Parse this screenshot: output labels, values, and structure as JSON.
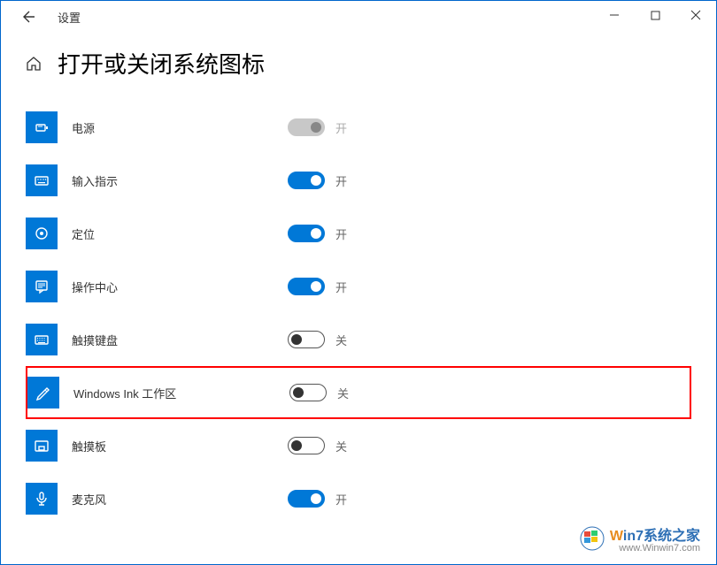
{
  "window": {
    "title": "设置"
  },
  "page": {
    "heading": "打开或关闭系统图标"
  },
  "state_labels": {
    "on": "开",
    "off": "关"
  },
  "items": [
    {
      "icon": "power",
      "label": "电源",
      "state": "on",
      "disabled": true
    },
    {
      "icon": "keyboard-ime",
      "label": "输入指示",
      "state": "on",
      "disabled": false
    },
    {
      "icon": "location",
      "label": "定位",
      "state": "on",
      "disabled": false
    },
    {
      "icon": "action-center",
      "label": "操作中心",
      "state": "on",
      "disabled": false
    },
    {
      "icon": "touch-keyboard",
      "label": "触摸键盘",
      "state": "off",
      "disabled": false
    },
    {
      "icon": "windows-ink",
      "label": "Windows Ink 工作区",
      "state": "off",
      "disabled": false,
      "highlighted": true
    },
    {
      "icon": "touchpad",
      "label": "触摸板",
      "state": "off",
      "disabled": false
    },
    {
      "icon": "microphone",
      "label": "麦克风",
      "state": "on",
      "disabled": false
    }
  ],
  "watermark": {
    "line1_part1": "W",
    "line1_part2": "in7系统之家",
    "line2": "www.Winwin7.com"
  }
}
